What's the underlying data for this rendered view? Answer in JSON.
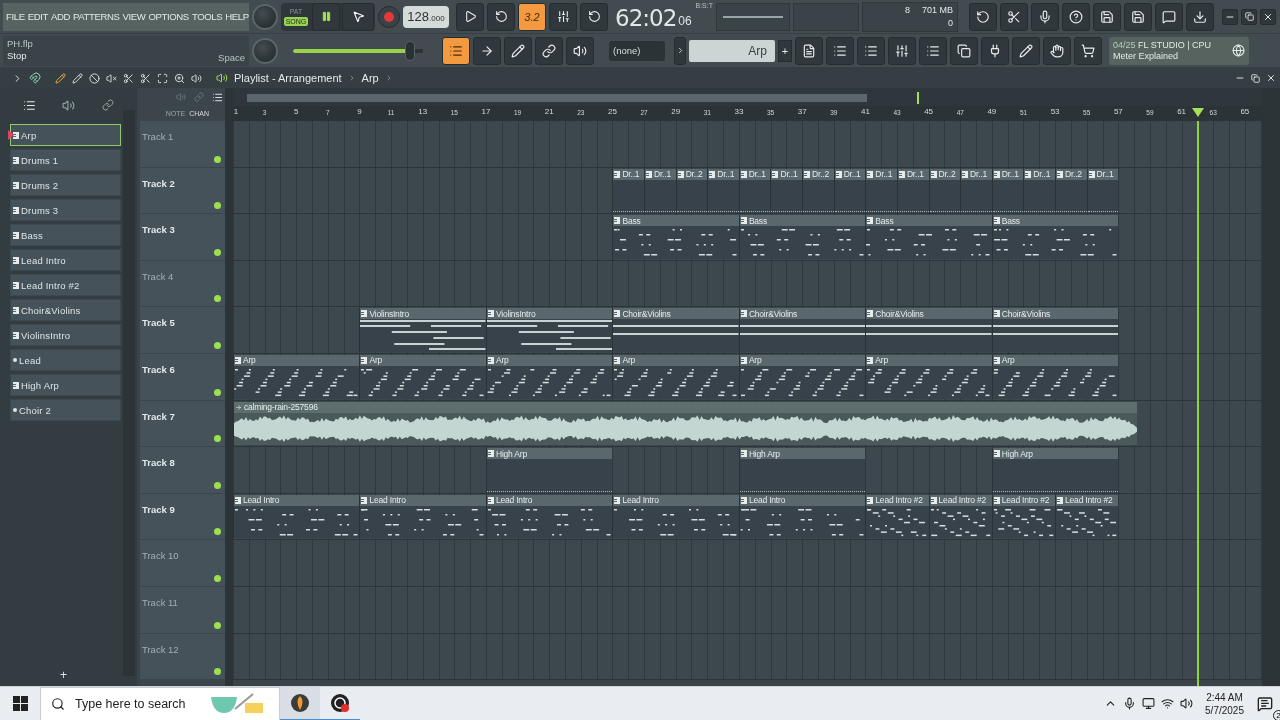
{
  "menu": [
    "FILE",
    "EDIT",
    "ADD",
    "PATTERNS",
    "VIEW",
    "OPTIONS",
    "TOOLS",
    "HELP"
  ],
  "hint_panel": {
    "file": "PH.flp",
    "action": "Stop",
    "shortcut": "Space"
  },
  "transport": {
    "modes": [
      {
        "label": "PAT",
        "selected": false
      },
      {
        "label": "SONG",
        "selected": true
      }
    ],
    "tempo": {
      "whole": "128",
      "fraction": ".000"
    },
    "countdown": "3.2"
  },
  "time": {
    "main": "62:02",
    "sub": "06",
    "format": "B:S:T"
  },
  "cpu": {
    "polyphony": "8",
    "memory": "701 MB",
    "value": "0"
  },
  "master_volume": {
    "level": 0.9
  },
  "channel_selector": "(none)",
  "pattern_selector": {
    "name": "Arp",
    "add": "+"
  },
  "news": {
    "date": "04/25",
    "title": "FL STUDIO | CPU",
    "subtitle": "Meter Explained"
  },
  "playlist": {
    "title": "Playlist - Arrangement",
    "pattern": "Arp",
    "column_labels": [
      "NOTE",
      "CHAN"
    ],
    "add": "+",
    "playhead": {
      "level": 0.937
    },
    "ruler": [
      "1",
      "3",
      "5",
      "7",
      "9",
      "11",
      "13",
      "15",
      "17",
      "19",
      "21",
      "23",
      "25",
      "27",
      "29",
      "31",
      "33",
      "35",
      "37",
      "39",
      "41",
      "43",
      "45",
      "47",
      "49",
      "51",
      "53",
      "55",
      "57",
      "59",
      "61",
      "63",
      "65"
    ],
    "patterns": [
      {
        "name": "Arp",
        "kind": "pattern",
        "selected": true
      },
      {
        "name": "Drums 1",
        "kind": "pattern",
        "selected": false
      },
      {
        "name": "Drums 2",
        "kind": "pattern",
        "selected": false
      },
      {
        "name": "Drums 3",
        "kind": "pattern",
        "selected": false
      },
      {
        "name": "Bass",
        "kind": "pattern",
        "selected": false
      },
      {
        "name": "Lead Intro",
        "kind": "pattern",
        "selected": false
      },
      {
        "name": "Lead Intro #2",
        "kind": "pattern",
        "selected": false
      },
      {
        "name": "Choir&Violins",
        "kind": "pattern",
        "selected": false
      },
      {
        "name": "ViolinsIntro",
        "kind": "pattern",
        "selected": false
      },
      {
        "name": "Lead",
        "kind": "empty",
        "selected": false
      },
      {
        "name": "High Arp",
        "kind": "pattern",
        "selected": false
      },
      {
        "name": "Choir 2",
        "kind": "empty",
        "selected": false
      }
    ],
    "tracks": [
      {
        "name": "Track 1",
        "dimmed": true
      },
      {
        "name": "Track 2",
        "dimmed": false,
        "clips": [
          {
            "kind": "gap"
          },
          {
            "kind": "gap"
          },
          {
            "kind": "gap"
          },
          {
            "name": "Dr..1",
            "kind": "drums"
          },
          {
            "name": "Dr..1",
            "kind": "drums"
          },
          {
            "name": "Dr..2",
            "kind": "drums"
          },
          {
            "name": "Dr..1",
            "kind": "drums"
          },
          {
            "name": "Dr..1",
            "kind": "drums"
          },
          {
            "name": "Dr..1",
            "kind": "drums"
          },
          {
            "name": "Dr..2",
            "kind": "drums"
          },
          {
            "name": "Dr..1",
            "kind": "drums"
          },
          {
            "name": "Dr..1",
            "kind": "drums"
          },
          {
            "name": "Dr..1",
            "kind": "drums"
          },
          {
            "name": "Dr..2",
            "kind": "drums"
          },
          {
            "name": "Dr..1",
            "kind": "drums"
          },
          {
            "name": "Dr..1",
            "kind": "drums"
          },
          {
            "name": "Dr..1",
            "kind": "drums"
          },
          {
            "name": "Dr..2",
            "kind": "drums"
          },
          {
            "name": "Dr..1",
            "kind": "drums"
          }
        ]
      },
      {
        "name": "Track 3",
        "dimmed": false,
        "clips": [
          {
            "kind": "gap"
          },
          {
            "kind": "gap"
          },
          {
            "kind": "gap"
          },
          {
            "name": "Bass",
            "kind": "bass"
          },
          {
            "name": "Bass",
            "kind": "bass"
          },
          {
            "name": "Bass",
            "kind": "bass"
          },
          {
            "name": "Bass",
            "kind": "bass"
          }
        ]
      },
      {
        "name": "Track 4",
        "dimmed": true
      },
      {
        "name": "Track 5",
        "dimmed": false,
        "clips": [
          {
            "kind": "gap"
          },
          {
            "name": "ViolinsIntro",
            "kind": "strings"
          },
          {
            "name": "ViolinsIntro",
            "kind": "strings"
          },
          {
            "name": "Choir&Violins",
            "kind": "pad"
          },
          {
            "name": "Choir&Violins",
            "kind": "pad"
          },
          {
            "name": "Choir&Violins",
            "kind": "pad"
          },
          {
            "name": "Choir&Violins",
            "kind": "pad"
          }
        ]
      },
      {
        "name": "Track 6",
        "dimmed": false,
        "clips": [
          {
            "name": "Arp",
            "kind": "arp"
          },
          {
            "name": "Arp",
            "kind": "arp"
          },
          {
            "name": "Arp",
            "kind": "arp"
          },
          {
            "name": "Arp",
            "kind": "arp"
          },
          {
            "name": "Arp",
            "kind": "arp"
          },
          {
            "name": "Arp",
            "kind": "arp"
          },
          {
            "name": "Arp",
            "kind": "arp"
          }
        ]
      },
      {
        "name": "Track 7",
        "dimmed": false,
        "clips": [
          {
            "name": "calming-rain-257596",
            "kind": "audio"
          }
        ]
      },
      {
        "name": "Track 8",
        "dimmed": false,
        "clips": [
          {
            "kind": "gap"
          },
          {
            "kind": "gap"
          },
          {
            "name": "High Arp",
            "kind": "sparse"
          },
          {
            "kind": "gap"
          },
          {
            "name": "High Arp",
            "kind": "sparse"
          },
          {
            "kind": "gap"
          },
          {
            "name": "High Arp",
            "kind": "sparse"
          }
        ]
      },
      {
        "name": "Track 9",
        "dimmed": false,
        "clips": [
          {
            "name": "Lead Intro",
            "kind": "riff"
          },
          {
            "name": "Lead Intro",
            "kind": "riff"
          },
          {
            "name": "Lead Intro",
            "kind": "riff"
          },
          {
            "name": "Lead Intro",
            "kind": "riff"
          },
          {
            "name": "Lead Intro",
            "kind": "riff"
          },
          {
            "name": "Lead Intro #2",
            "kind": "trill"
          },
          {
            "name": "Lead Intro #2",
            "kind": "trill"
          },
          {
            "name": "Lead Intro #2",
            "kind": "trill"
          },
          {
            "name": "Lead Intro #2",
            "kind": "trill"
          }
        ]
      },
      {
        "name": "Track 10",
        "dimmed": true
      },
      {
        "name": "Track 11",
        "dimmed": true
      },
      {
        "name": "Track 12",
        "dimmed": true
      }
    ]
  },
  "taskbar": {
    "search_placeholder": "Type here to search",
    "time": "2:44 AM",
    "date": "5/7/2025",
    "notifications": "2"
  }
}
